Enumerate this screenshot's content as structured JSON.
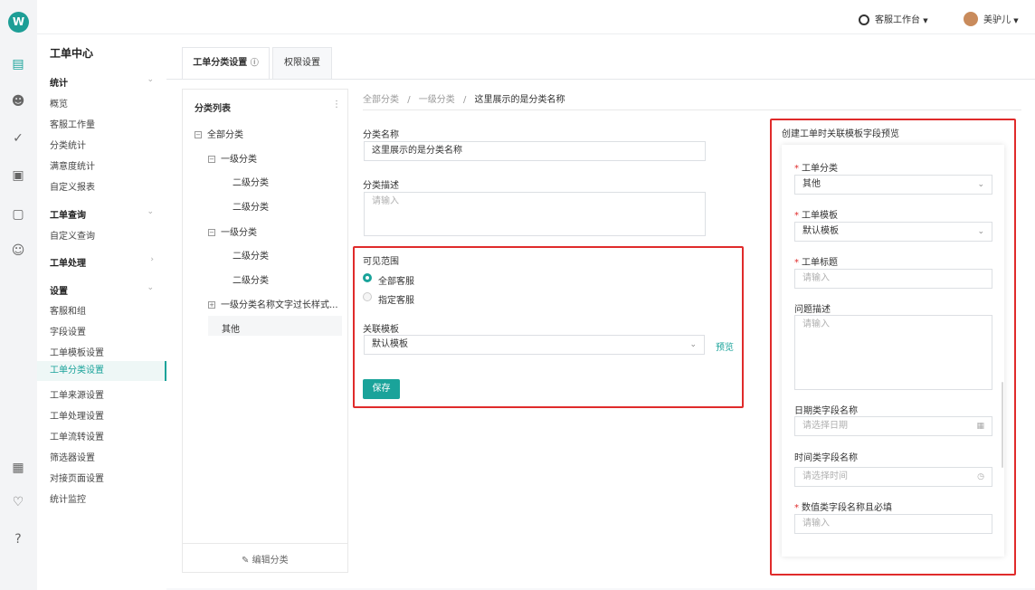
{
  "app": {
    "logo_glyph": "W"
  },
  "topbar": {
    "workspace_label": "客服工作台",
    "user_name": "美驴儿"
  },
  "menu": {
    "title": "工单中心",
    "groups": [
      {
        "label": "统计",
        "items": [
          "概览",
          "客服工作量",
          "分类统计",
          "满意度统计",
          "自定义报表"
        ]
      },
      {
        "label": "工单查询",
        "items": [
          "自定义查询"
        ]
      },
      {
        "label": "工单处理",
        "items": []
      },
      {
        "label": "设置",
        "items": [
          "客服和组",
          "字段设置",
          "工单模板设置",
          "工单分类设置",
          "工单来源设置",
          "工单处理设置",
          "工单流转设置",
          "筛选器设置",
          "对接页面设置",
          "统计监控"
        ]
      }
    ],
    "active_item": "工单分类设置"
  },
  "tabs": [
    {
      "label": "工单分类设置"
    },
    {
      "label": "权限设置"
    }
  ],
  "tree": {
    "header": "分类列表",
    "root": "全部分类",
    "level1_a": "一级分类",
    "level2_a1": "二级分类",
    "level2_a2": "二级分类",
    "level1_b": "一级分类",
    "level2_b1": "二级分类",
    "level2_b2": "二级分类",
    "level1_c": "一级分类名称文字过长样式...",
    "other": "其他",
    "footer": "编辑分类"
  },
  "breadcrumb": {
    "b1": "全部分类",
    "sep": "/",
    "b2": "一级分类",
    "b3": "这里展示的是分类名称"
  },
  "form": {
    "name_label": "分类名称",
    "name_value": "这里展示的是分类名称",
    "desc_label": "分类描述",
    "desc_placeholder": "请输入",
    "scope_label": "可见范围",
    "scope_all": "全部客服",
    "scope_specific": "指定客服",
    "template_label": "关联模板",
    "template_value": "默认模板",
    "preview_link": "预览",
    "save_button": "保存"
  },
  "preview": {
    "title": "创建工单时关联模板字段预览",
    "f1_label": "工单分类",
    "f1_value": "其他",
    "f2_label": "工单模板",
    "f2_value": "默认模板",
    "f3_label": "工单标题",
    "f3_placeholder": "请输入",
    "f4_label": "问题描述",
    "f4_placeholder": "请输入",
    "f5_label": "日期类字段名称",
    "f5_placeholder": "请选择日期",
    "f6_label": "时间类字段名称",
    "f6_placeholder": "请选择时间",
    "f7_label": "数值类字段名称且必填",
    "f7_placeholder": "请输入",
    "required_mark": "*"
  },
  "colors": {
    "accent": "#1aa39a",
    "highlight": "#e02b2b"
  }
}
